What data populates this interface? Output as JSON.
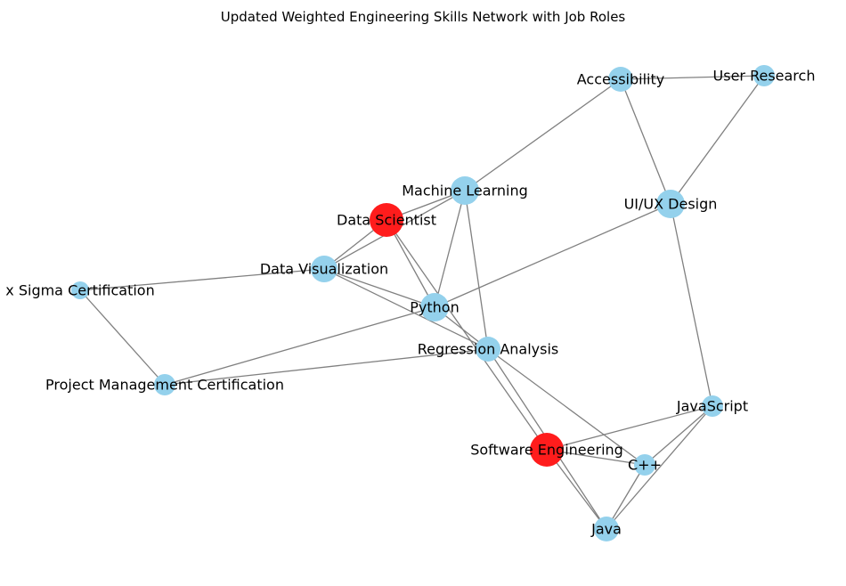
{
  "title": "Updated Weighted Engineering Skills Network with Job Roles",
  "colors": {
    "skill": "#94d1ec",
    "role": "#ff1c1c",
    "edge": "#808080"
  },
  "nodes": [
    {
      "id": "accessibility",
      "label": "Accessibility",
      "kind": "skill"
    },
    {
      "id": "user_research",
      "label": "User Research",
      "kind": "skill"
    },
    {
      "id": "machine_learning",
      "label": "Machine Learning",
      "kind": "skill"
    },
    {
      "id": "ui_ux",
      "label": "UI/UX Design",
      "kind": "skill"
    },
    {
      "id": "data_scientist",
      "label": "Data Scientist",
      "kind": "role"
    },
    {
      "id": "data_viz",
      "label": "Data Visualization",
      "kind": "skill"
    },
    {
      "id": "six_sigma",
      "label": "x Sigma Certification",
      "kind": "skill"
    },
    {
      "id": "python",
      "label": "Python",
      "kind": "skill"
    },
    {
      "id": "regression",
      "label": "Regression Analysis",
      "kind": "skill"
    },
    {
      "id": "pm_cert",
      "label": "Project Management Certification",
      "kind": "skill"
    },
    {
      "id": "javascript",
      "label": "JavaScript",
      "kind": "skill"
    },
    {
      "id": "software_eng",
      "label": "Software Engineering",
      "kind": "role"
    },
    {
      "id": "cpp",
      "label": "C++",
      "kind": "skill"
    },
    {
      "id": "java",
      "label": "Java",
      "kind": "skill"
    }
  ],
  "edges": [
    [
      "accessibility",
      "user_research"
    ],
    [
      "accessibility",
      "machine_learning"
    ],
    [
      "accessibility",
      "ui_ux"
    ],
    [
      "user_research",
      "ui_ux"
    ],
    [
      "ui_ux",
      "python"
    ],
    [
      "ui_ux",
      "javascript"
    ],
    [
      "machine_learning",
      "data_scientist"
    ],
    [
      "machine_learning",
      "python"
    ],
    [
      "machine_learning",
      "regression"
    ],
    [
      "machine_learning",
      "data_viz"
    ],
    [
      "data_scientist",
      "data_viz"
    ],
    [
      "data_scientist",
      "python"
    ],
    [
      "data_scientist",
      "software_eng"
    ],
    [
      "data_viz",
      "six_sigma"
    ],
    [
      "data_viz",
      "python"
    ],
    [
      "data_viz",
      "regression"
    ],
    [
      "six_sigma",
      "pm_cert"
    ],
    [
      "pm_cert",
      "python"
    ],
    [
      "pm_cert",
      "regression"
    ],
    [
      "python",
      "regression"
    ],
    [
      "regression",
      "cpp"
    ],
    [
      "regression",
      "java"
    ],
    [
      "software_eng",
      "javascript"
    ],
    [
      "software_eng",
      "cpp"
    ],
    [
      "software_eng",
      "java"
    ],
    [
      "javascript",
      "cpp"
    ],
    [
      "javascript",
      "java"
    ],
    [
      "cpp",
      "java"
    ]
  ]
}
